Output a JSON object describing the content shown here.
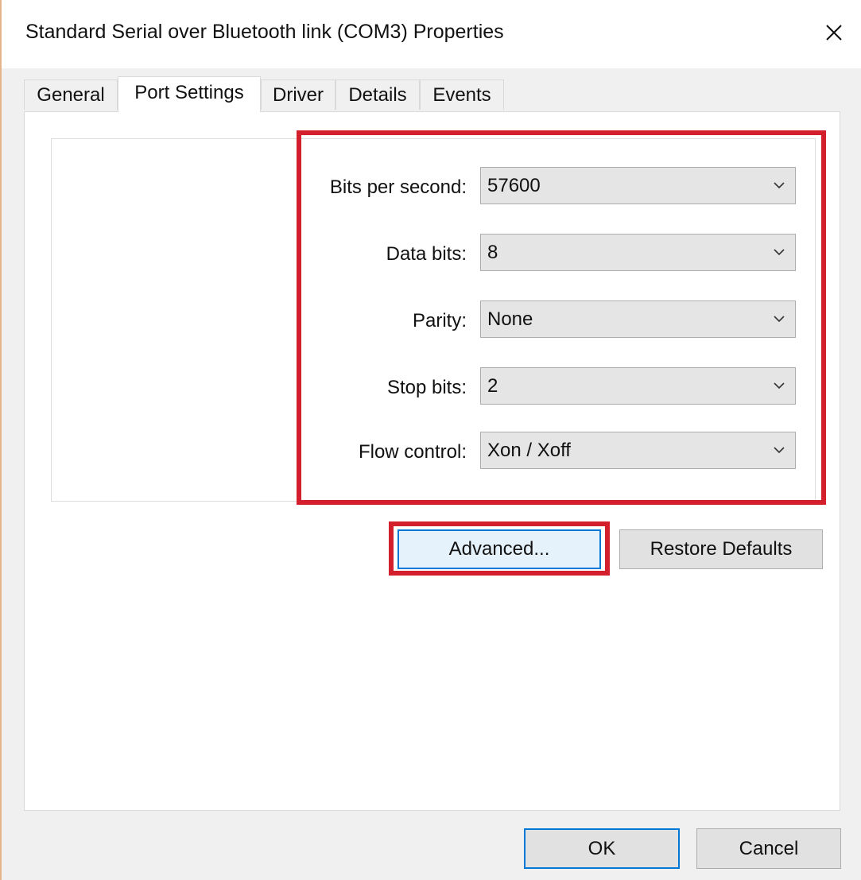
{
  "window": {
    "title": "Standard Serial over Bluetooth link (COM3) Properties"
  },
  "tabs": [
    {
      "label": "General",
      "active": false
    },
    {
      "label": "Port Settings",
      "active": true
    },
    {
      "label": "Driver",
      "active": false
    },
    {
      "label": "Details",
      "active": false
    },
    {
      "label": "Events",
      "active": false
    }
  ],
  "port_settings": {
    "bits_per_second": {
      "label": "Bits per second:",
      "value": "57600"
    },
    "data_bits": {
      "label": "Data bits:",
      "value": "8"
    },
    "parity": {
      "label": "Parity:",
      "value": "None"
    },
    "stop_bits": {
      "label": "Stop bits:",
      "value": "2"
    },
    "flow_control": {
      "label": "Flow control:",
      "value": "Xon / Xoff"
    }
  },
  "buttons": {
    "advanced": "Advanced...",
    "restore_defaults": "Restore Defaults",
    "ok": "OK",
    "cancel": "Cancel"
  },
  "icons": {
    "close": "close-icon",
    "dropdown": "chevron-down-icon"
  },
  "colors": {
    "highlight": "#d41f2c",
    "focus_accent": "#0078d7"
  }
}
